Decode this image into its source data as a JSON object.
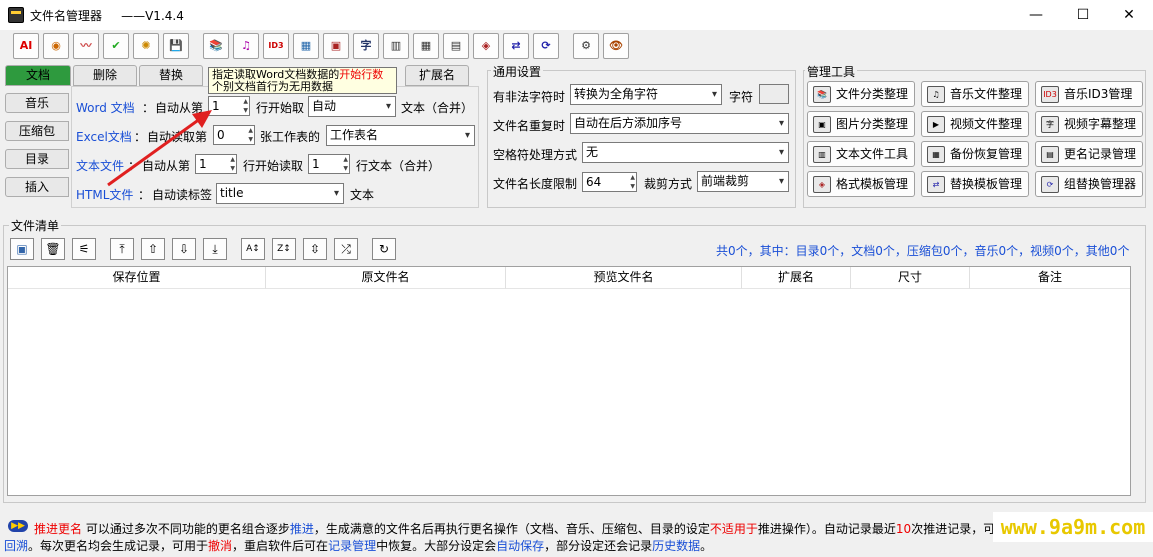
{
  "window": {
    "title": "文件名管理器",
    "version": "——V1.4.4",
    "minimize": "—",
    "maximize": "☐",
    "close": "✕"
  },
  "toolbar": {
    "items": [
      "AI",
      "◉",
      "〰",
      "✔",
      "✺",
      "💾",
      "📚",
      "♫",
      "ID3",
      "▦",
      "▣",
      "字",
      "▥",
      "▦",
      "▤",
      "◈",
      "⇄",
      "⟳",
      "⚙",
      "👁"
    ]
  },
  "tabs": {
    "doc": "文档",
    "delete": "删除",
    "replace": "替换",
    "ext": "扩展名"
  },
  "side_tabs": {
    "music": "音乐",
    "zip": "压缩包",
    "dir": "目录",
    "insert": "插入"
  },
  "tooltip": {
    "pre": "指定读取Word文档数据的",
    "highlight": "开始行数",
    "line2": "个别文档首行为无用数据"
  },
  "word": {
    "label": "Word 文档",
    "colon": "：",
    "auto_from": "自动从第",
    "value": "1",
    "start_read": "行开始取",
    "mode": "自动",
    "suffix": "文本（合并）"
  },
  "excel": {
    "label": "Excel文档",
    "colon": "：",
    "auto_read": "自动读取第",
    "value": "0",
    "sheet_label": "张工作表的",
    "sheet_value": "工作表名"
  },
  "text": {
    "label": "文本文件",
    "colon": "：",
    "auto_from": "自动从第",
    "value": "1",
    "start_read": "行开始读取",
    "value2": "1",
    "suffix": "行文本（合并）"
  },
  "html": {
    "label": "HTML文件",
    "colon": "：",
    "auto_tag": "自动读标签",
    "tag_value": "title",
    "suffix": "文本"
  },
  "general": {
    "title": "通用设置",
    "illegal_label": "有非法字符时",
    "illegal_value": "转换为全角字符",
    "char_label": "字符",
    "dup_label": "文件名重复时",
    "dup_value": "自动在后方添加序号",
    "space_label": "空格符处理方式",
    "space_value": "无",
    "len_label": "文件名长度限制",
    "len_value": "64",
    "trim_label": "裁剪方式",
    "trim_value": "前端裁剪"
  },
  "manager": {
    "title": "管理工具",
    "buttons": [
      {
        "label": "文件分类整理",
        "icon": "📚"
      },
      {
        "label": "音乐文件整理",
        "icon": "♫"
      },
      {
        "label": "音乐ID3管理",
        "icon": "ID3"
      },
      {
        "label": "图片分类整理",
        "icon": "▣"
      },
      {
        "label": "视频文件整理",
        "icon": "▶"
      },
      {
        "label": "视频字幕整理",
        "icon": "字"
      },
      {
        "label": "文本文件工具",
        "icon": "▥"
      },
      {
        "label": "备份恢复管理",
        "icon": "▦"
      },
      {
        "label": "更名记录管理",
        "icon": "▤"
      },
      {
        "label": "格式模板管理",
        "icon": "◈"
      },
      {
        "label": "替换模板管理",
        "icon": "⇄"
      },
      {
        "label": "组替换管理器",
        "icon": "⟳"
      }
    ]
  },
  "filelist": {
    "title": "文件清单",
    "summary": "共0个，其中：目录0个，文档0个，压缩包0个，音乐0个，视频0个，其他0个",
    "buttons": [
      "▣",
      "🗑",
      "⚟",
      "⤒",
      "⇧",
      "⇩",
      "⤓",
      "A↕",
      "Z↕",
      "⇳",
      "⤮",
      "↻"
    ],
    "columns": [
      "保存位置",
      "原文件名",
      "预览文件名",
      "扩展名",
      "尺寸",
      "备注"
    ]
  },
  "status": {
    "p1": "推进更名",
    "p2": "  可以通过多次不同功能的更名组合逐步",
    "p3": "推进",
    "p4": "，生成满意的文件名后再执行更名操作（文档、音乐、压缩包、目录的设定",
    "p5": "不适用于",
    "p6": "推进操作）。自动记录最近",
    "p7": "10",
    "p8": "次推进记录，可",
    "p9": "回溯",
    "p10": "。每次更名均会生成记录，可用于",
    "p11": "撤消",
    "p12": "，重启软件后可在",
    "p13": "记录管理",
    "p14": "中恢复。大部分设定会",
    "p15": "自动保存",
    "p16": "，部分设定还会记录",
    "p17": "历史数据",
    "p18": "。"
  },
  "watermark": "www.9a9m.com",
  "colors": {
    "accent_tab": "#2e9a3e",
    "link_blue": "#1a4fd6",
    "highlight_red": "#e00000",
    "watermark": "#e8c800"
  }
}
